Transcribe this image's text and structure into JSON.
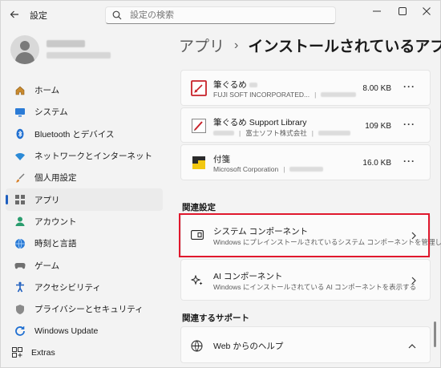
{
  "window": {
    "title": "設定",
    "search_placeholder": "設定の検索",
    "minimize_label": "—",
    "maximize_label": "☐",
    "close_label": "✕"
  },
  "profile": {
    "name": "",
    "email": ""
  },
  "sidebar": {
    "items": [
      {
        "label": "ホーム",
        "icon": "home-icon"
      },
      {
        "label": "システム",
        "icon": "system-icon"
      },
      {
        "label": "Bluetooth とデバイス",
        "icon": "bluetooth-icon"
      },
      {
        "label": "ネットワークとインターネット",
        "icon": "network-icon"
      },
      {
        "label": "個人用設定",
        "icon": "brush-icon"
      },
      {
        "label": "アプリ",
        "icon": "apps-icon",
        "active": true
      },
      {
        "label": "アカウント",
        "icon": "account-icon"
      },
      {
        "label": "時刻と言語",
        "icon": "globe-clock-icon"
      },
      {
        "label": "ゲーム",
        "icon": "gamepad-icon"
      },
      {
        "label": "アクセシビリティ",
        "icon": "accessibility-icon"
      },
      {
        "label": "プライバシーとセキュリティ",
        "icon": "shield-icon"
      },
      {
        "label": "Windows Update",
        "icon": "update-icon"
      }
    ],
    "extras_label": "Extras"
  },
  "breadcrumb": {
    "parent": "アプリ",
    "separator": "›",
    "current": "インストールされているアプリ"
  },
  "apps": [
    {
      "name": "筆ぐるめ",
      "publisher": "FUJI SOFT INCORPORATED...",
      "size": "8.00 KB",
      "more": "···"
    },
    {
      "name": "筆ぐるめ Support Library",
      "publisher": "富士ソフト株式会社",
      "size": "109 KB",
      "more": "···"
    },
    {
      "name": "付箋",
      "publisher": "Microsoft Corporation",
      "size": "16.0 KB",
      "more": "···"
    }
  ],
  "related_settings": {
    "title": "関連設定",
    "items": [
      {
        "title": "システム コンポーネント",
        "desc": "Windows にプレインストールされているシステム コンポーネントを管理します",
        "icon": "component-icon"
      },
      {
        "title": "AI コンポーネント",
        "desc": "Windows にインストールされている AI コンポーネントを表示する",
        "icon": "sparkle-icon"
      }
    ]
  },
  "related_support": {
    "title": "関連するサポート",
    "item": {
      "title": "Web からのヘルプ",
      "icon": "globe-icon"
    }
  },
  "colors": {
    "accent": "#1f5fbf",
    "highlight": "#e0182d"
  }
}
